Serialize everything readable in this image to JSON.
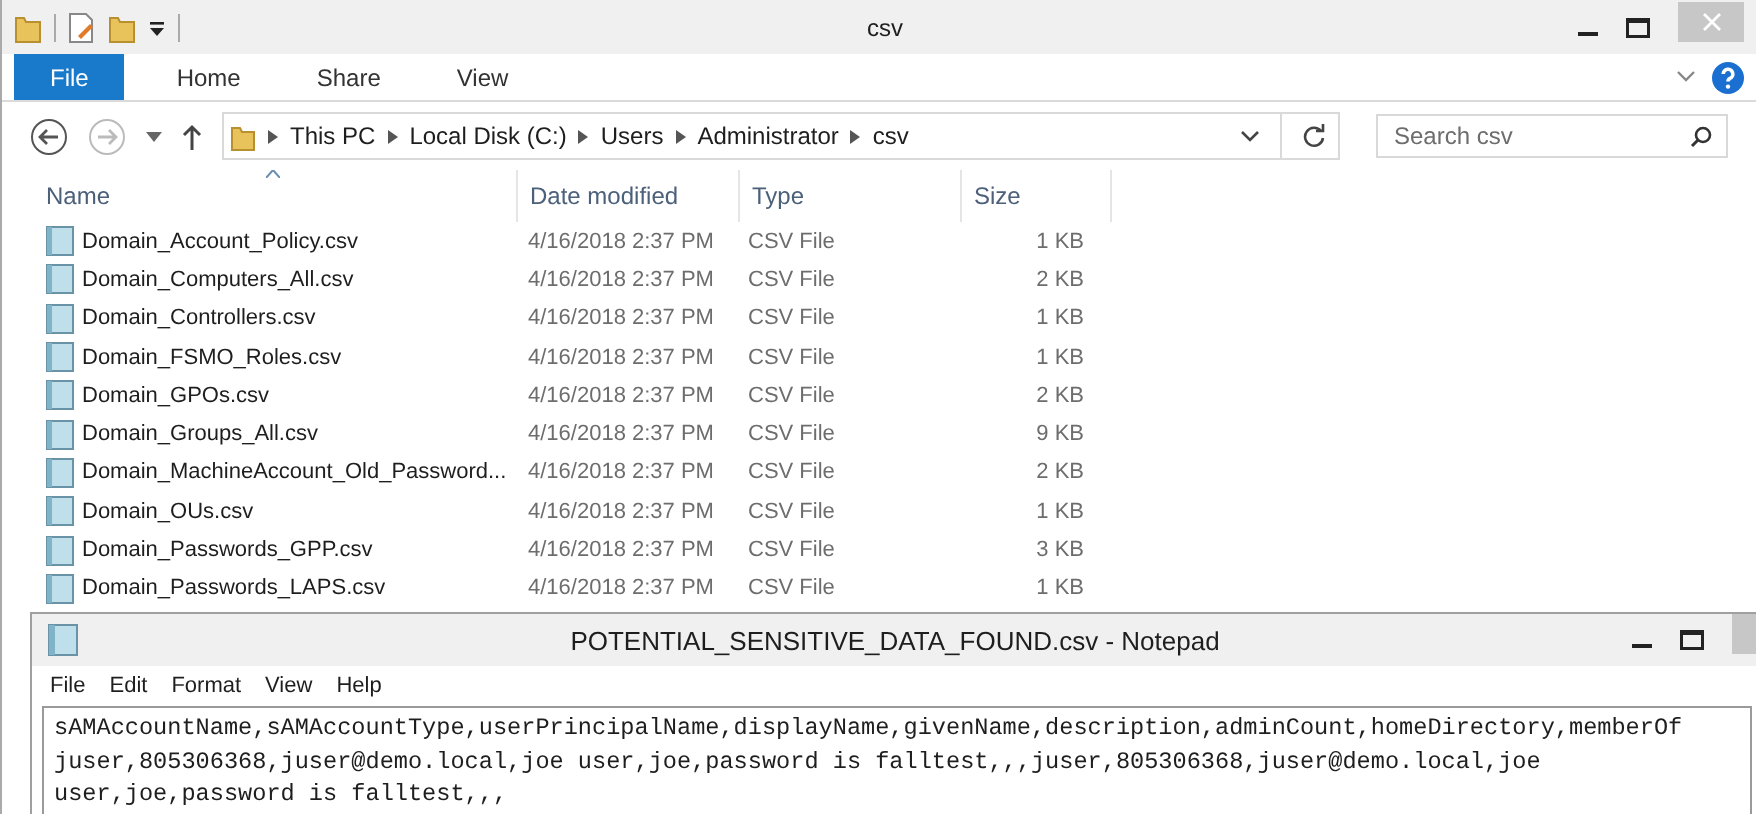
{
  "explorer": {
    "title": "csv",
    "ribbon_tabs": [
      {
        "label": "File",
        "selected": true
      },
      {
        "label": "Home",
        "selected": false
      },
      {
        "label": "Share",
        "selected": false
      },
      {
        "label": "View",
        "selected": false
      }
    ],
    "breadcrumbs": [
      "This PC",
      "Local Disk (C:)",
      "Users",
      "Administrator",
      "csv"
    ],
    "search": {
      "placeholder": "Search csv"
    },
    "columns": [
      "Name",
      "Date modified",
      "Type",
      "Size"
    ],
    "rows": [
      {
        "name": "Domain_Account_Policy.csv",
        "date": "4/16/2018 2:37 PM",
        "type": "CSV File",
        "size": "1 KB"
      },
      {
        "name": "Domain_Computers_All.csv",
        "date": "4/16/2018 2:37 PM",
        "type": "CSV File",
        "size": "2 KB"
      },
      {
        "name": "Domain_Controllers.csv",
        "date": "4/16/2018 2:37 PM",
        "type": "CSV File",
        "size": "1 KB"
      },
      {
        "name": "Domain_FSMO_Roles.csv",
        "date": "4/16/2018 2:37 PM",
        "type": "CSV File",
        "size": "1 KB"
      },
      {
        "name": "Domain_GPOs.csv",
        "date": "4/16/2018 2:37 PM",
        "type": "CSV File",
        "size": "2 KB"
      },
      {
        "name": "Domain_Groups_All.csv",
        "date": "4/16/2018 2:37 PM",
        "type": "CSV File",
        "size": "9 KB"
      },
      {
        "name": "Domain_MachineAccount_Old_Password...",
        "date": "4/16/2018 2:37 PM",
        "type": "CSV File",
        "size": "2 KB"
      },
      {
        "name": "Domain_OUs.csv",
        "date": "4/16/2018 2:37 PM",
        "type": "CSV File",
        "size": "1 KB"
      },
      {
        "name": "Domain_Passwords_GPP.csv",
        "date": "4/16/2018 2:37 PM",
        "type": "CSV File",
        "size": "3 KB"
      },
      {
        "name": "Domain_Passwords_LAPS.csv",
        "date": "4/16/2018 2:37 PM",
        "type": "CSV File",
        "size": "1 KB"
      }
    ]
  },
  "notepad": {
    "title": "POTENTIAL_SENSITIVE_DATA_FOUND.csv - Notepad",
    "menu": [
      "File",
      "Edit",
      "Format",
      "View",
      "Help"
    ],
    "lines": [
      "sAMAccountName,sAMAccountType,userPrincipalName,displayName,givenName,description,adminCount,homeDirectory,memberOf",
      "juser,805306368,juser@demo.local,joe user,joe,password is falltest,,,juser,805306368,juser@demo.local,joe",
      "user,joe,password is falltest,,,"
    ]
  }
}
